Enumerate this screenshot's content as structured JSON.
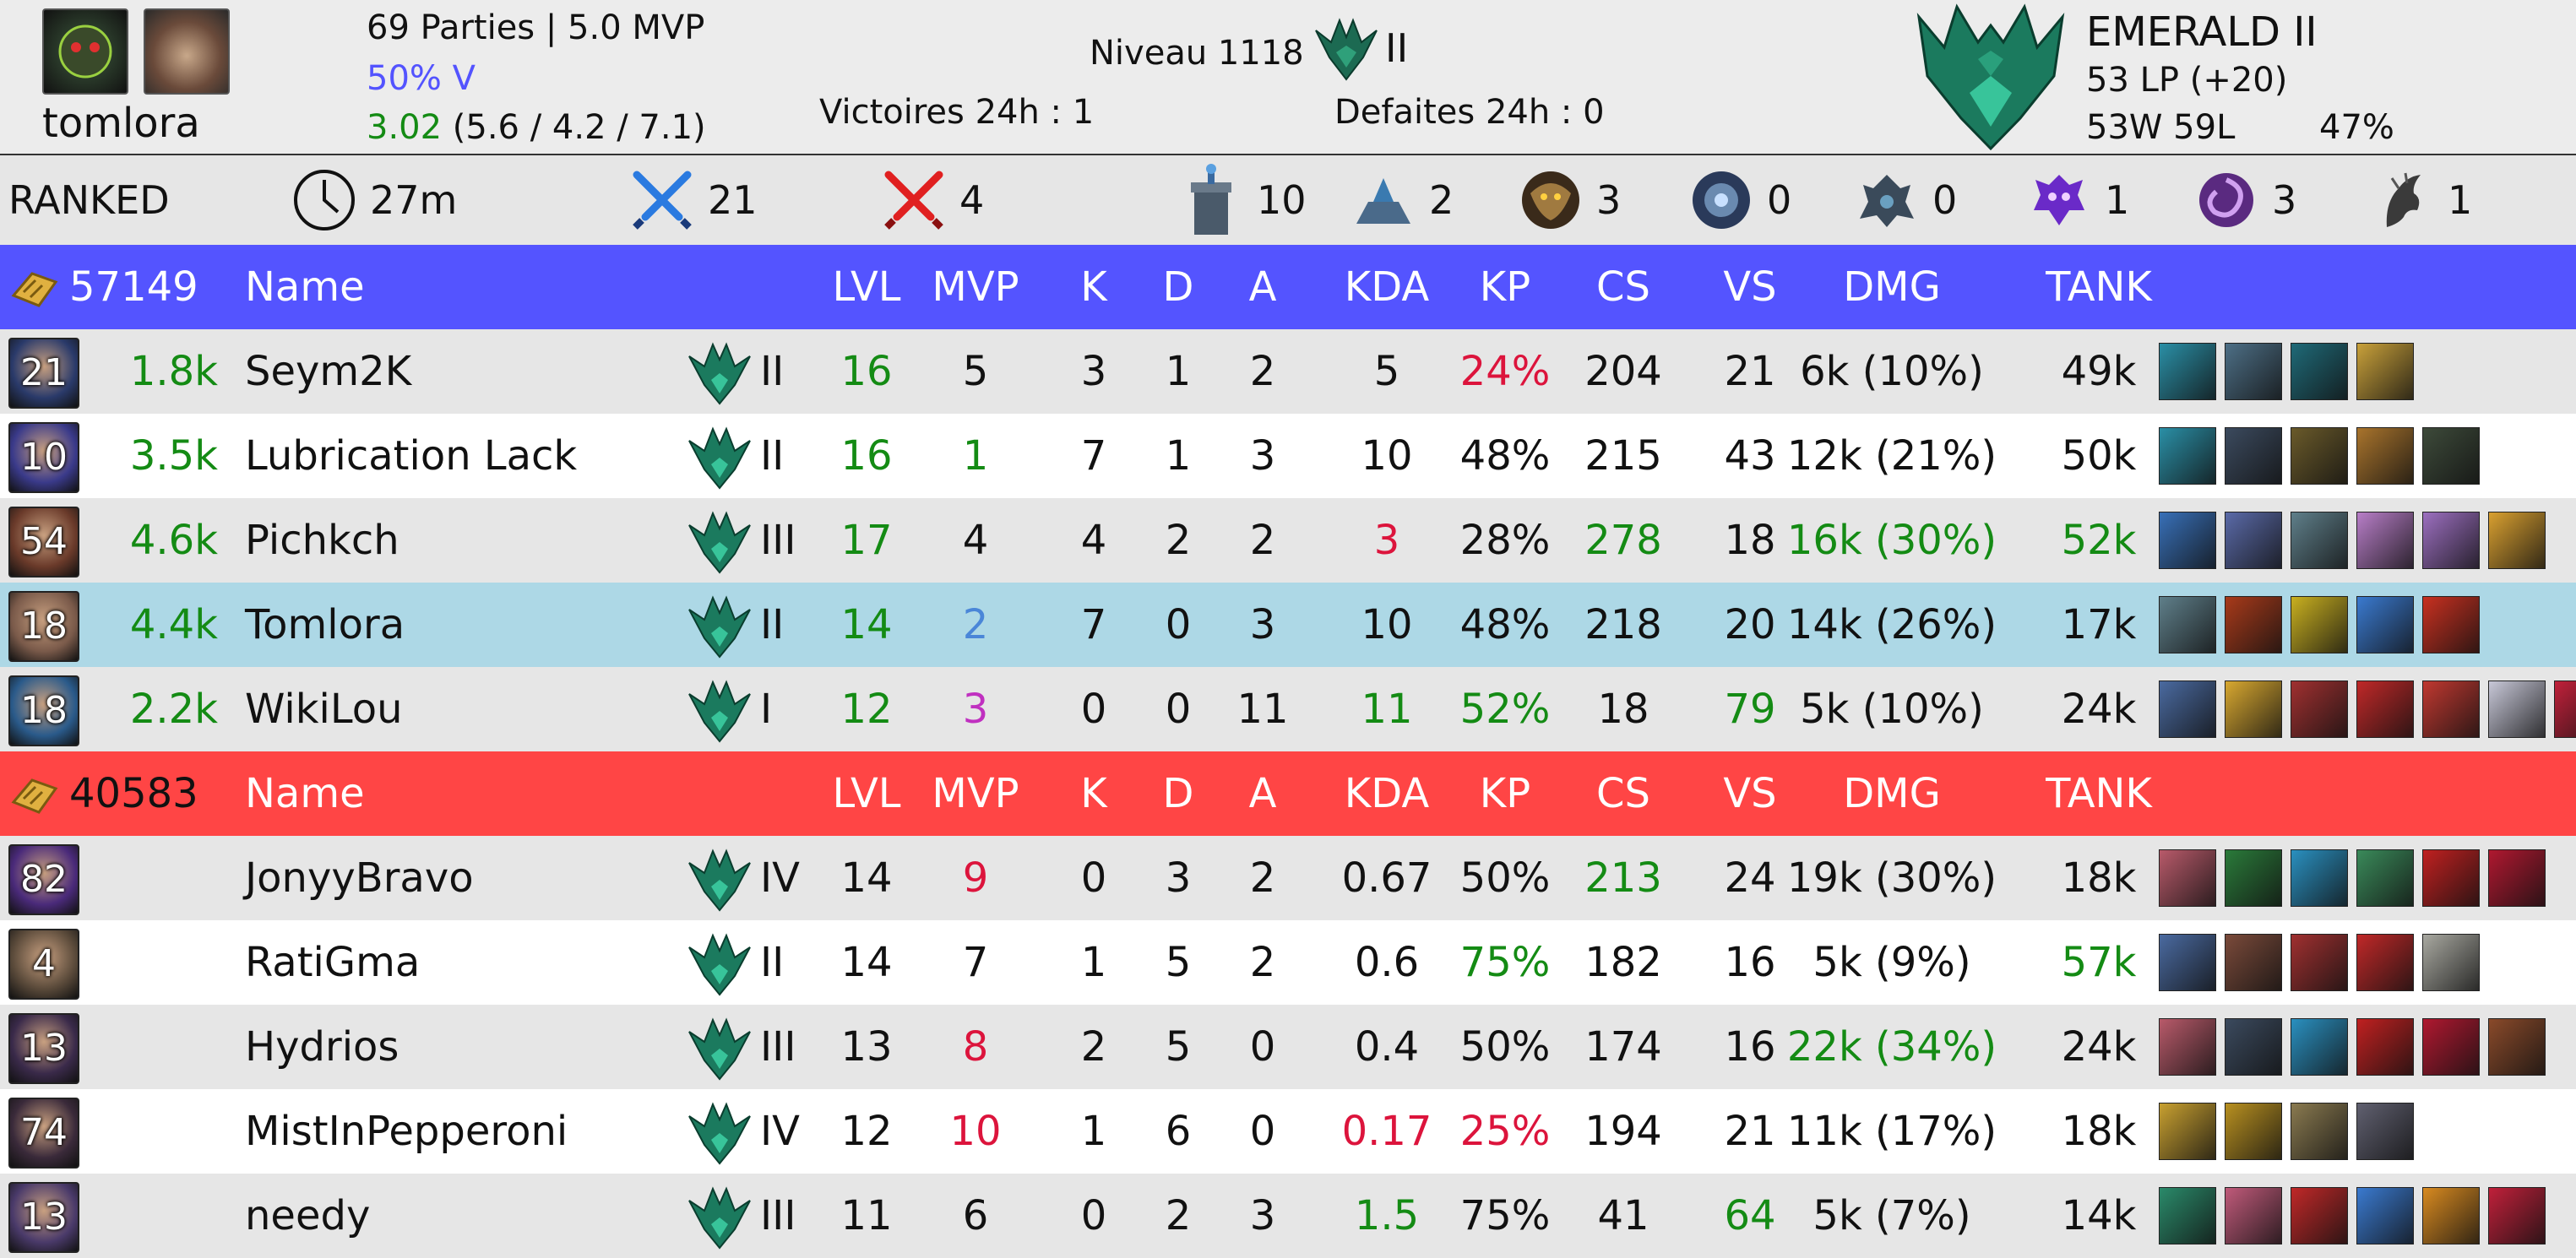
{
  "header": {
    "username": "tomlora",
    "games_mvp": "69 Parties | 5.0 MVP",
    "winrate": "50% V",
    "kda_ratio": "3.02",
    "kda_detail": "(5.6 / 4.2 / 7.1)",
    "level": "Niveau 1118",
    "level_rank": "II",
    "wins_24h": "Victoires 24h : 1",
    "losses_24h": "Defaites 24h : 0",
    "tier": "EMERALD II",
    "lp": "53 LP (+20)",
    "wl": "53W 59L",
    "wl_pct": "47%"
  },
  "stats": {
    "mode": "RANKED",
    "duration": "27m",
    "kills_blue": "21",
    "kills_red": "4",
    "towers": "10",
    "inhibs": "2",
    "barons": "3",
    "heralds": "0",
    "grubs": "0",
    "elder": "1",
    "atakhan": "3",
    "dragons": "1"
  },
  "columns": {
    "name": "Name",
    "lvl": "LVL",
    "mvp": "MVP",
    "k": "K",
    "d": "D",
    "a": "A",
    "kda": "KDA",
    "kp": "KP",
    "cs": "CS",
    "vs": "VS",
    "dmg": "DMG",
    "tank": "TANK"
  },
  "colors": {
    "blue_team": "#5454ff",
    "red_team": "#ff4545",
    "highlight_row": "#add8e6",
    "green": "#148b14",
    "red": "#dc143c"
  },
  "teams": {
    "blue": {
      "gold": "57149",
      "players": [
        {
          "champ_level": "21",
          "gold_diff": "1.8k",
          "name": "Seym2K",
          "rank": "II",
          "lvl": "16",
          "mvp": "5",
          "k": "3",
          "d": "1",
          "a": "2",
          "kda": "5",
          "kp": "24%",
          "cs": "204",
          "vs": "21",
          "dmg": "6k (10%)",
          "tank": "49k",
          "items": [
            "#2a8fa6",
            "#4d6f86",
            "#1f6a78",
            "#c9a13a"
          ]
        },
        {
          "champ_level": "10",
          "gold_diff": "3.5k",
          "name": "Lubrication Lack",
          "rank": "II",
          "lvl": "16",
          "mvp": "1",
          "k": "7",
          "d": "1",
          "a": "3",
          "kda": "10",
          "kp": "48%",
          "cs": "215",
          "vs": "43",
          "dmg": "12k (21%)",
          "tank": "50k",
          "items": [
            "#2a8fa6",
            "#3b4a5e",
            "#6a5a2a",
            "#a9742c",
            "#3d4a3a"
          ]
        },
        {
          "champ_level": "54",
          "gold_diff": "4.6k",
          "name": "Pichkch",
          "rank": "III",
          "lvl": "17",
          "mvp": "4",
          "k": "4",
          "d": "2",
          "a": "2",
          "kda": "3",
          "kp": "28%",
          "cs": "278",
          "vs": "18",
          "dmg": "16k (30%)",
          "tank": "52k",
          "items": [
            "#3870b8",
            "#5a6aa8",
            "#5f7f8a",
            "#b87ec8",
            "#9c6fc0",
            "#d9a030"
          ]
        },
        {
          "champ_level": "18",
          "gold_diff": "4.4k",
          "name": "Tomlora",
          "rank": "II",
          "lvl": "14",
          "mvp": "2",
          "k": "7",
          "d": "0",
          "a": "3",
          "kda": "10",
          "kp": "48%",
          "cs": "218",
          "vs": "20",
          "dmg": "14k (26%)",
          "tank": "17k",
          "items": [
            "#5f7f8a",
            "#a83a1a",
            "#c9b020",
            "#3a7ad0",
            "#c83020"
          ]
        },
        {
          "champ_level": "18",
          "gold_diff": "2.2k",
          "name": "WikiLou",
          "rank": "I",
          "lvl": "12",
          "mvp": "3",
          "k": "0",
          "d": "0",
          "a": "11",
          "kda": "11",
          "kp": "52%",
          "cs": "18",
          "vs": "79",
          "dmg": "5k (10%)",
          "tank": "24k",
          "items": [
            "#4a6aa0",
            "#d8a830",
            "#a03030",
            "#c02828",
            "#c03830",
            "#c8c8d8",
            "#c0203a"
          ]
        }
      ]
    },
    "red": {
      "gold": "40583",
      "players": [
        {
          "champ_level": "82",
          "gold_diff": "",
          "name": "JonyyBravo",
          "rank": "IV",
          "lvl": "14",
          "mvp": "9",
          "k": "0",
          "d": "3",
          "a": "2",
          "kda": "0.67",
          "kp": "50%",
          "cs": "213",
          "vs": "24",
          "dmg": "19k (30%)",
          "tank": "18k",
          "items": [
            "#b85a6a",
            "#2a7a3a",
            "#2a90c0",
            "#3a8a5a",
            "#c02020",
            "#b01830"
          ]
        },
        {
          "champ_level": "4",
          "gold_diff": "",
          "name": "RatiGma",
          "rank": "II",
          "lvl": "14",
          "mvp": "7",
          "k": "1",
          "d": "5",
          "a": "2",
          "kda": "0.6",
          "kp": "75%",
          "cs": "182",
          "vs": "16",
          "dmg": "5k (9%)",
          "tank": "57k",
          "items": [
            "#4a6aa0",
            "#7a4a3a",
            "#a03030",
            "#c02828",
            "#a8a8a0"
          ]
        },
        {
          "champ_level": "13",
          "gold_diff": "",
          "name": "Hydrios",
          "rank": "III",
          "lvl": "13",
          "mvp": "8",
          "k": "2",
          "d": "5",
          "a": "0",
          "kda": "0.4",
          "kp": "50%",
          "cs": "174",
          "vs": "16",
          "dmg": "22k (34%)",
          "tank": "24k",
          "items": [
            "#b85a6a",
            "#3b4a5e",
            "#2a90c0",
            "#c02020",
            "#b01830",
            "#8a4a2a"
          ]
        },
        {
          "champ_level": "74",
          "gold_diff": "",
          "name": "MistInPepperoni",
          "rank": "IV",
          "lvl": "12",
          "mvp": "10",
          "k": "1",
          "d": "6",
          "a": "0",
          "kda": "0.17",
          "kp": "25%",
          "cs": "194",
          "vs": "21",
          "dmg": "11k (17%)",
          "tank": "18k",
          "items": [
            "#c8a030",
            "#b89020",
            "#8a7a50",
            "#606070"
          ]
        },
        {
          "champ_level": "13",
          "gold_diff": "",
          "name": "needy",
          "rank": "III",
          "lvl": "11",
          "mvp": "6",
          "k": "0",
          "d": "2",
          "a": "3",
          "kda": "1.5",
          "kp": "75%",
          "cs": "41",
          "vs": "64",
          "dmg": "5k (7%)",
          "tank": "14k",
          "items": [
            "#2a8a6a",
            "#c05a7a",
            "#c02828",
            "#3a7ad0",
            "#d88a20",
            "#c0203a"
          ]
        }
      ]
    }
  }
}
